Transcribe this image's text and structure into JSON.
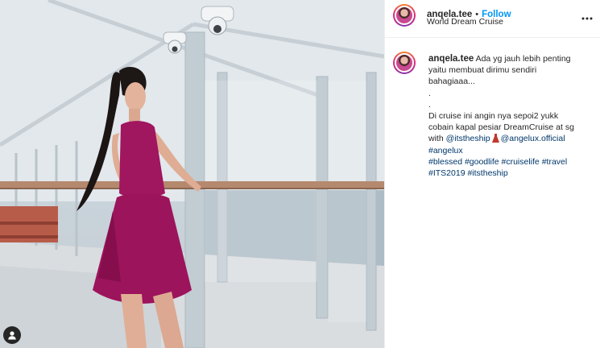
{
  "post": {
    "username": "anqela.tee",
    "follow_label": "Follow",
    "location": "World Dream Cruise",
    "more_icon": "more-horizontal-icon",
    "separator": "•"
  },
  "caption": {
    "username": "anqela.tee",
    "line1_rest": " Ada yg jauh lebih penting",
    "line2": "yaitu membuat dirimu sendiri",
    "line3": "bahagiaaa...",
    "line4": ".",
    "line5": ".",
    "line6": "Di cruise ini angin nya sepoi2 yukk",
    "line7": "cobain kapal pesiar DreamCruise at sg",
    "line8_prefix": "with ",
    "mention1": "@itstheship",
    "mention2": "@angelux.official",
    "hashtag_angelux": "#angelux",
    "hashtag_blessed": "#blessed",
    "hashtag_goodlife": "#goodlife",
    "hashtag_cruiselife": "#cruiselife",
    "hashtag_travel": "#travel",
    "hashtag_its2019": "#ITS2019",
    "hashtag_itstheship": "#itstheship"
  },
  "photo": {
    "tag_icon": "user-tag-icon",
    "dress_color": "#a0165f",
    "rail_color": "#b5896e",
    "sea_color": "#aebcc6"
  },
  "colors": {
    "link": "#00376b",
    "follow": "#0095f6",
    "text": "#262626"
  }
}
